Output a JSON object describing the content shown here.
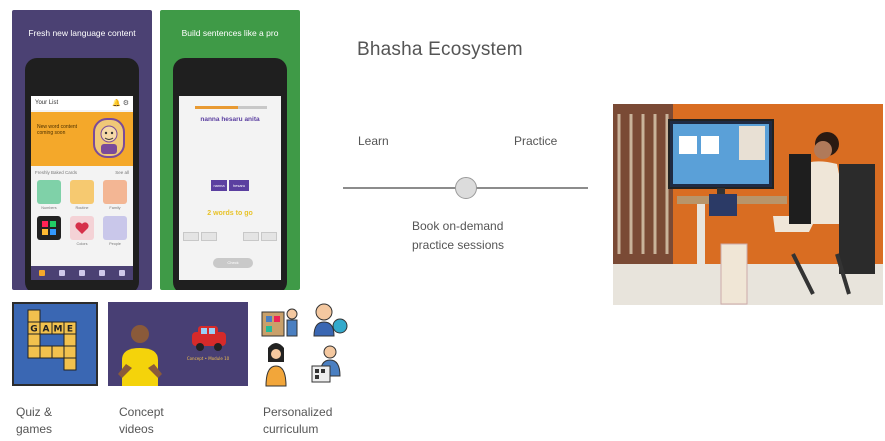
{
  "promos": [
    {
      "title": "Fresh new language content"
    },
    {
      "title": "Build sentences like a pro"
    }
  ],
  "phone1": {
    "header_title": "Your List",
    "header_icons": "🔔 ⚙",
    "hero_text": "New word content coming soon",
    "section_label": "Freshly Baked Cards",
    "see_all": "See all",
    "tile_captions": [
      "Numbers",
      "Routine",
      "Family",
      "",
      "Colors",
      "People"
    ]
  },
  "phone2": {
    "progress": 0.6,
    "sentence": "nanna hesaru anita",
    "chips": [
      "nanna",
      "hesaru"
    ],
    "words_to_go": "2 words to go",
    "check_label": "Check"
  },
  "cards": {
    "quiz_word": [
      "G",
      "A",
      "M",
      "E"
    ],
    "quiz_caption": "Quiz &\ngames",
    "video_caption": "Concept\nvideos",
    "video_car_label": "Concept • Module 10",
    "curriculum_caption": "Personalized\ncurriculum"
  },
  "ecosystem": {
    "title": "Bhasha Ecosystem",
    "learn_label": "Learn",
    "practice_label": "Practice",
    "slider_value": 0.5,
    "book_text": "Book on-demand\npractice sessions"
  },
  "colors": {
    "purple": "#4b4173",
    "green": "#3f9a47",
    "orange": "#f4a82a",
    "quiz_blue": "#3a67b3",
    "wall_orange": "#e07a2a"
  }
}
